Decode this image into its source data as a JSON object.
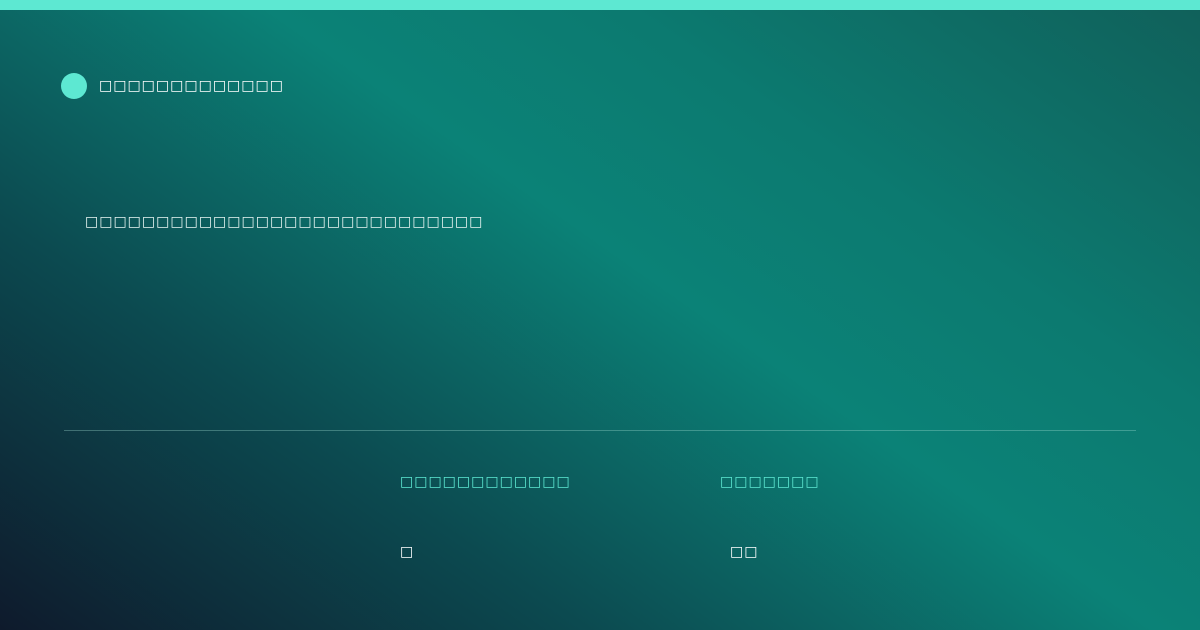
{
  "brand": {
    "name": "□□□□□□□□□□□□□",
    "accent_color": "#5de8d2"
  },
  "headline": {
    "text": "□□□□□□□□□□□□□□□□□□□□□□□□□□□□"
  },
  "stats": [
    {
      "label": "□□□□□□□□□□□□",
      "value": "□"
    },
    {
      "label": "□□□□□□□",
      "value": "□□"
    }
  ],
  "colors": {
    "top_bar": "#5de8d2",
    "background_dark": "#0e1a2c",
    "background_teal": "#0b8277",
    "label_color": "#5de8d2",
    "text_color": "#ffffff"
  }
}
